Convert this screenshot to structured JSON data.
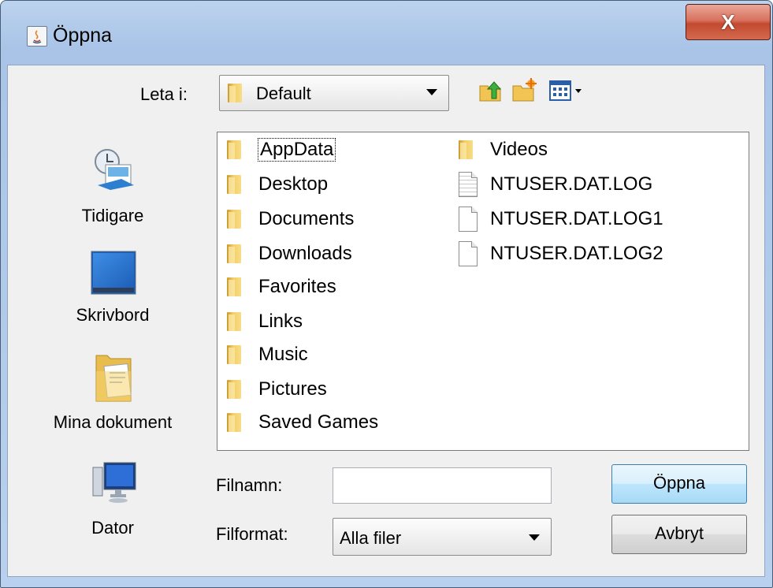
{
  "window": {
    "title": "Öppna",
    "close_label": "X"
  },
  "lookin": {
    "label": "Leta i:",
    "value": "Default"
  },
  "toolbar": {
    "up_icon": "up-one-level-icon",
    "new_folder_icon": "new-folder-icon",
    "view_icon": "view-menu-icon"
  },
  "sidebar": {
    "items": [
      {
        "label": "Tidigare",
        "icon": "recent-icon"
      },
      {
        "label": "Skrivbord",
        "icon": "desktop-icon"
      },
      {
        "label": "Mina dokument",
        "icon": "documents-icon"
      },
      {
        "label": "Dator",
        "icon": "computer-icon"
      }
    ]
  },
  "files": {
    "column1": [
      {
        "name": "AppData",
        "type": "folder",
        "selected": true
      },
      {
        "name": "Desktop",
        "type": "folder"
      },
      {
        "name": "Documents",
        "type": "folder"
      },
      {
        "name": "Downloads",
        "type": "folder"
      },
      {
        "name": "Favorites",
        "type": "folder"
      },
      {
        "name": "Links",
        "type": "folder"
      },
      {
        "name": "Music",
        "type": "folder"
      },
      {
        "name": "Pictures",
        "type": "folder"
      },
      {
        "name": "Saved Games",
        "type": "folder"
      }
    ],
    "column2": [
      {
        "name": "Videos",
        "type": "folder"
      },
      {
        "name": "NTUSER.DAT.LOG",
        "type": "file-lines"
      },
      {
        "name": "NTUSER.DAT.LOG1",
        "type": "file"
      },
      {
        "name": "NTUSER.DAT.LOG2",
        "type": "file"
      }
    ]
  },
  "filename": {
    "label": "Filnamn:",
    "value": ""
  },
  "filetype": {
    "label": "Filformat:",
    "value": "Alla filer"
  },
  "buttons": {
    "open": "Öppna",
    "cancel": "Avbryt"
  }
}
